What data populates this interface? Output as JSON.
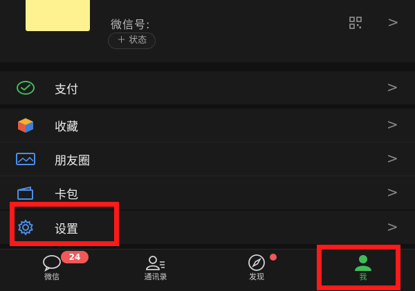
{
  "profile": {
    "wechat_id_label": "微信号:",
    "status_button_label": "＋ 状态"
  },
  "menu": {
    "items": [
      {
        "key": "pay",
        "label": "支付",
        "icon": "wechat-pay-icon"
      },
      {
        "key": "favorites",
        "label": "收藏",
        "icon": "favorites-cube-icon"
      },
      {
        "key": "moments",
        "label": "朋友圈",
        "icon": "moments-photo-icon"
      },
      {
        "key": "card_package",
        "label": "卡包",
        "icon": "card-wallet-icon"
      },
      {
        "key": "settings",
        "label": "设置",
        "icon": "settings-gear-icon"
      }
    ],
    "chevron": ">"
  },
  "tabbar": {
    "tabs": [
      {
        "key": "chats",
        "label": "微信",
        "icon": "chat-bubble-icon",
        "badge": "24"
      },
      {
        "key": "contacts",
        "label": "通讯录",
        "icon": "contacts-icon"
      },
      {
        "key": "discover",
        "label": "发现",
        "icon": "compass-icon",
        "dot": true
      },
      {
        "key": "me",
        "label": "我",
        "icon": "person-icon",
        "active": true
      }
    ]
  },
  "colors": {
    "background": "#111111",
    "row": "#1a1a1a",
    "accent_green": "#3fbd5a",
    "badge_red": "#f25858",
    "highlight_red": "#ff1a1a",
    "avatar_yellow": "#fdf28f"
  }
}
